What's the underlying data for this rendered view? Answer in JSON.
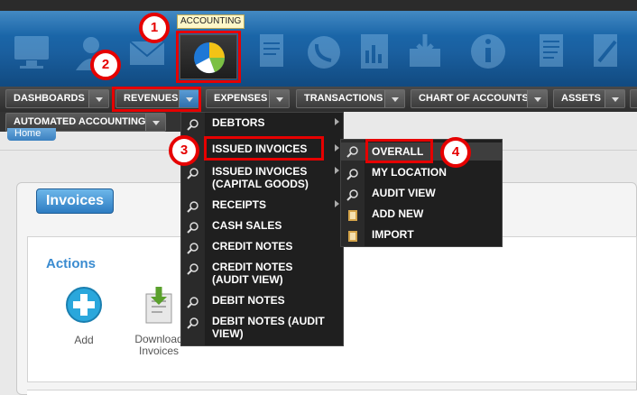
{
  "tooltip": "ACCOUNTING",
  "callouts": [
    "1",
    "2",
    "3",
    "4"
  ],
  "nav": {
    "dashboards": "DASHBOARDS",
    "revenues": "REVENUES",
    "expenses": "EXPENSES",
    "transactions": "TRANSACTIONS",
    "chart_of_accounts": "CHART OF ACCOUNTS",
    "assets": "ASSETS",
    "automated_accounting": "AUTOMATED ACCOUNTING"
  },
  "home_tab": "Home",
  "panel_title": "Invoices",
  "actions_title": "Actions",
  "actions": [
    {
      "label": "Add"
    },
    {
      "label": "Download Invoices"
    }
  ],
  "revenues_menu": [
    {
      "label": "DEBTORS"
    },
    {
      "label": "ISSUED INVOICES"
    },
    {
      "label": "ISSUED INVOICES (CAPITAL GOODS)"
    },
    {
      "label": "RECEIPTS"
    },
    {
      "label": "CASH SALES"
    },
    {
      "label": "CREDIT NOTES"
    },
    {
      "label": "CREDIT NOTES (AUDIT VIEW)"
    },
    {
      "label": "DEBIT NOTES"
    },
    {
      "label": "DEBIT NOTES (AUDIT VIEW)"
    }
  ],
  "issued_invoices_submenu": [
    {
      "label": "OVERALL"
    },
    {
      "label": "MY LOCATION"
    },
    {
      "label": "AUDIT VIEW"
    },
    {
      "label": "ADD NEW"
    },
    {
      "label": "IMPORT"
    }
  ],
  "colors": {
    "highlight": "#e60000",
    "accent": "#3a8bd0",
    "menu_bg": "#1f1f1f"
  }
}
